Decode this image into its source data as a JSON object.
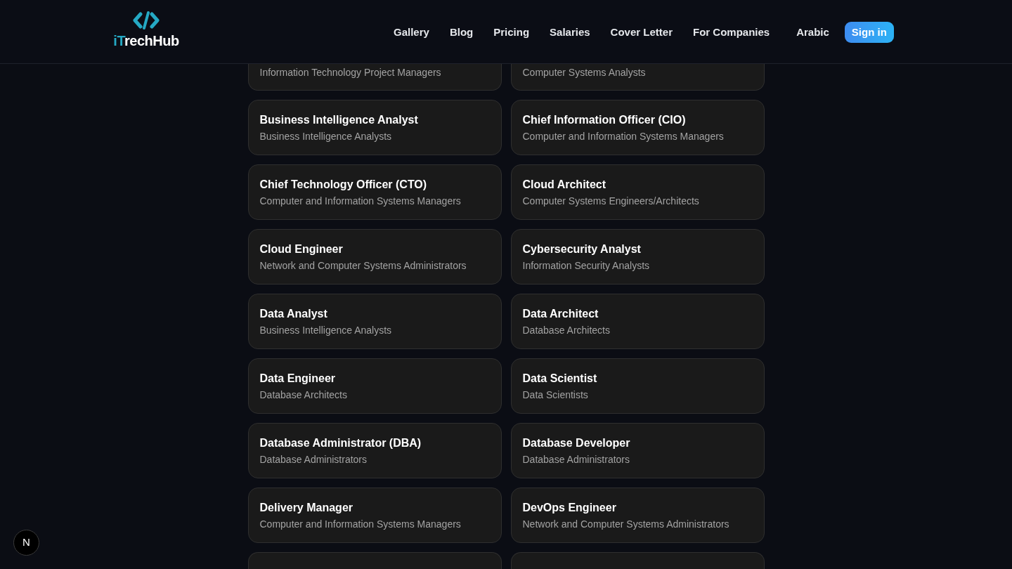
{
  "logo": {
    "accent": "iT",
    "rest": "rechHub"
  },
  "nav": [
    {
      "label": "Gallery"
    },
    {
      "label": "Blog"
    },
    {
      "label": "Pricing"
    },
    {
      "label": "Salaries"
    },
    {
      "label": "Cover Letter"
    },
    {
      "label": "For Companies"
    }
  ],
  "language": "Arabic",
  "sign_in": "Sign in",
  "cards": [
    {
      "kind": "partial",
      "subtitle": "Information Technology Project Managers"
    },
    {
      "kind": "partial",
      "subtitle": "Computer Systems Analysts"
    },
    {
      "kind": "full",
      "title": "Business Intelligence Analyst",
      "subtitle": "Business Intelligence Analysts"
    },
    {
      "kind": "full",
      "title": "Chief Information Officer (CIO)",
      "subtitle": "Computer and Information Systems Managers"
    },
    {
      "kind": "full",
      "title": "Chief Technology Officer (CTO)",
      "subtitle": "Computer and Information Systems Managers"
    },
    {
      "kind": "full",
      "title": "Cloud Architect",
      "subtitle": "Computer Systems Engineers/Architects"
    },
    {
      "kind": "full",
      "title": "Cloud Engineer",
      "subtitle": "Network and Computer Systems Administrators"
    },
    {
      "kind": "full",
      "title": "Cybersecurity Analyst",
      "subtitle": "Information Security Analysts"
    },
    {
      "kind": "full",
      "title": "Data Analyst",
      "subtitle": "Business Intelligence Analysts"
    },
    {
      "kind": "full",
      "title": "Data Architect",
      "subtitle": "Database Architects"
    },
    {
      "kind": "full",
      "title": "Data Engineer",
      "subtitle": "Database Architects"
    },
    {
      "kind": "full",
      "title": "Data Scientist",
      "subtitle": "Data Scientists"
    },
    {
      "kind": "full",
      "title": "Database Administrator (DBA)",
      "subtitle": "Database Administrators"
    },
    {
      "kind": "full",
      "title": "Database Developer",
      "subtitle": "Database Administrators"
    },
    {
      "kind": "full",
      "title": "Delivery Manager",
      "subtitle": "Computer and Information Systems Managers"
    },
    {
      "kind": "full",
      "title": "DevOps Engineer",
      "subtitle": "Network and Computer Systems Administrators"
    },
    {
      "kind": "empty"
    },
    {
      "kind": "empty"
    }
  ],
  "badge": "N"
}
